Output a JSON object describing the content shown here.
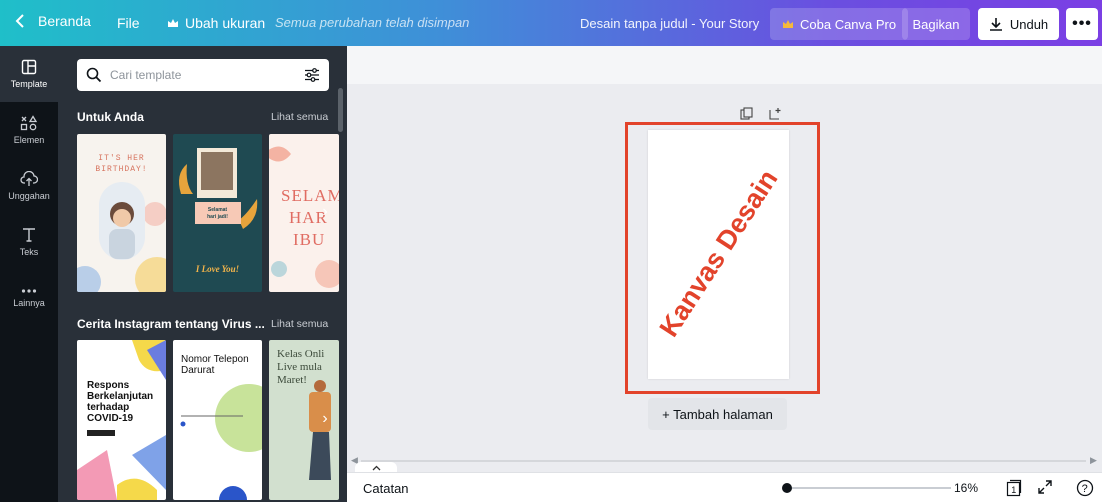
{
  "topbar": {
    "back_label": "Beranda",
    "file_label": "File",
    "resize_label": "Ubah ukuran",
    "saved_status": "Semua perubahan telah disimpan",
    "doc_title": "Desain tanpa judul - Your Story",
    "pro_label": "Coba Canva Pro",
    "share_label": "Bagikan",
    "download_label": "Unduh",
    "more_label": "•••"
  },
  "rail": {
    "items": [
      {
        "label": "Template",
        "icon": "template-icon"
      },
      {
        "label": "Elemen",
        "icon": "elements-icon"
      },
      {
        "label": "Unggahan",
        "icon": "upload-icon"
      },
      {
        "label": "Teks",
        "icon": "text-icon"
      },
      {
        "label": "Lainnya",
        "icon": "more-dots-icon"
      }
    ]
  },
  "panel": {
    "search_placeholder": "Cari template",
    "sections": [
      {
        "title": "Untuk Anda",
        "see_all": "Lihat semua",
        "thumbs": [
          {
            "text1": "IT'S HER",
            "text2": "BIRTHDAY!"
          },
          {
            "text1": "Selamat",
            "text2": "hari jadi!",
            "text3": "I Love You!"
          },
          {
            "text1": "SELAM",
            "text2": "HAR",
            "text3": "IBU"
          }
        ]
      },
      {
        "title": "Cerita Instagram tentang Virus ...",
        "see_all": "Lihat semua",
        "thumbs": [
          {
            "text1": "Respons Berkelanjutan terhadap COVID-19"
          },
          {
            "text1": "Nomor Telepon Darurat"
          },
          {
            "text1": "Kelas Onli Live mula Maret!"
          }
        ]
      }
    ]
  },
  "canvas": {
    "overlay_text": "Kanvas Desain",
    "add_page_label": "+ Tambah halaman"
  },
  "bottombar": {
    "notes_label": "Catatan",
    "zoom_value": "16%",
    "page_count": "1",
    "help_label": "?"
  },
  "colors": {
    "accent_red": "#e2432b",
    "rail_bg": "#0e1318",
    "panel_bg": "#293039"
  }
}
